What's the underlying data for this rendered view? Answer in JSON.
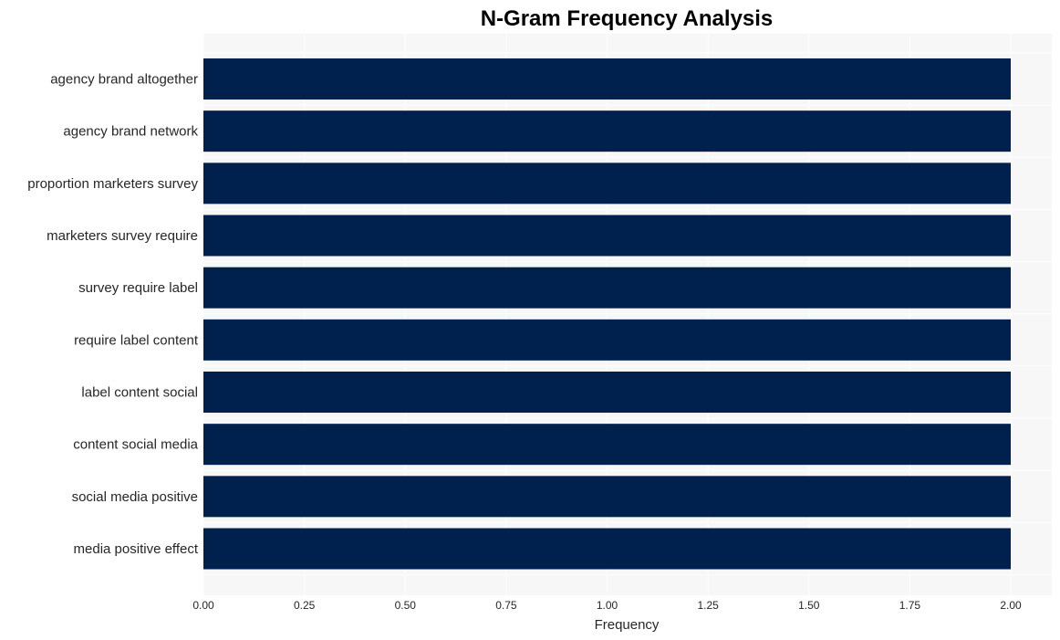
{
  "chart_data": {
    "type": "bar",
    "orientation": "horizontal",
    "title": "N-Gram Frequency Analysis",
    "xlabel": "Frequency",
    "ylabel": "",
    "categories": [
      "agency brand altogether",
      "agency brand network",
      "proportion marketers survey",
      "marketers survey require",
      "survey require label",
      "require label content",
      "label content social",
      "content social media",
      "social media positive",
      "media positive effect"
    ],
    "values": [
      2,
      2,
      2,
      2,
      2,
      2,
      2,
      2,
      2,
      2
    ],
    "xlim": [
      0,
      2.1
    ],
    "xticks": [
      0.0,
      0.25,
      0.5,
      0.75,
      1.0,
      1.25,
      1.5,
      1.75,
      2.0
    ],
    "xtick_labels": [
      "0.00",
      "0.25",
      "0.50",
      "0.75",
      "1.00",
      "1.25",
      "1.50",
      "1.75",
      "2.00"
    ],
    "grid": true,
    "legend": "none",
    "colors": {
      "bar": "#00214d",
      "plot_background": "#f7f7f7",
      "grid": "#ffffff"
    }
  }
}
